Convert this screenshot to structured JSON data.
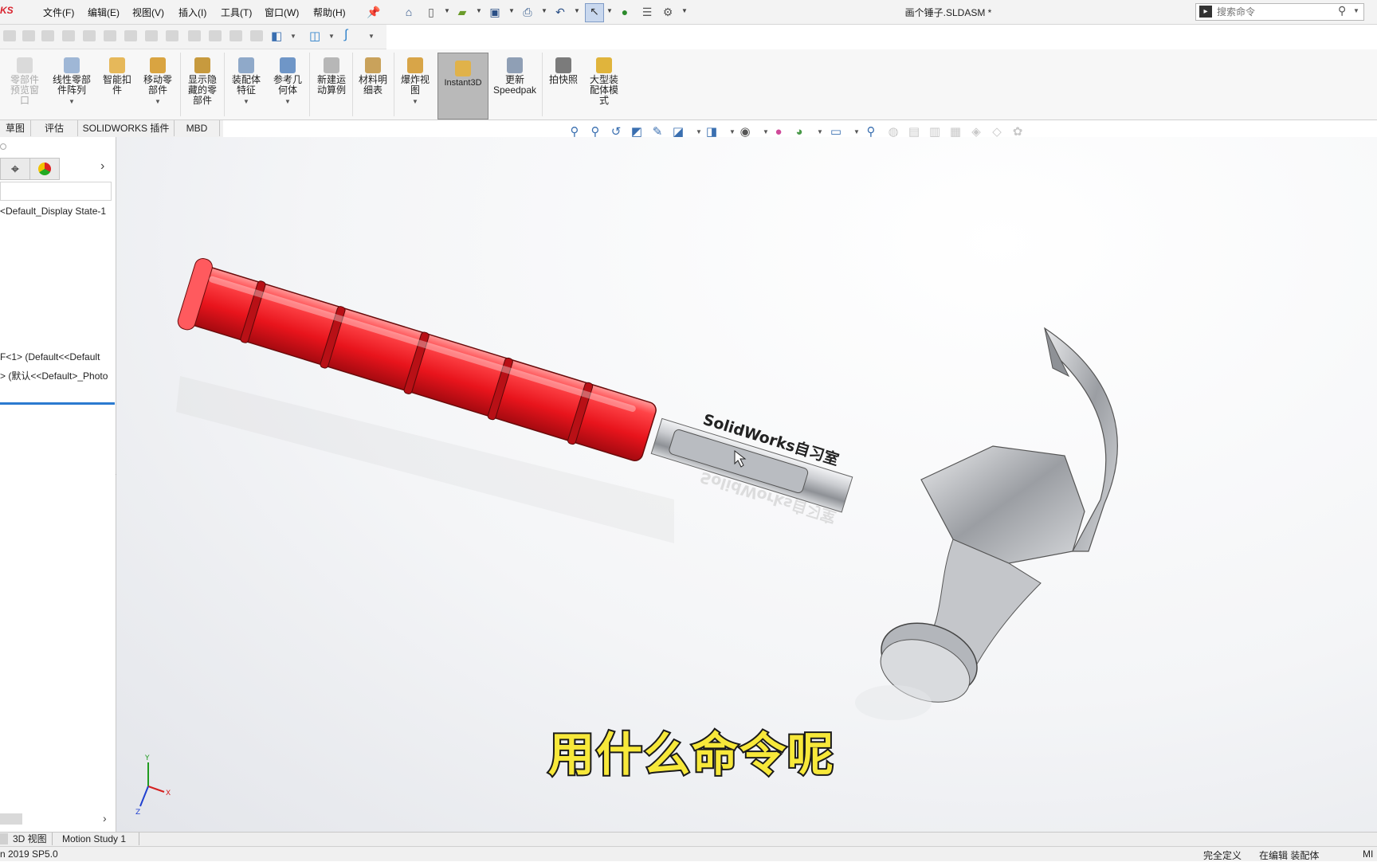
{
  "app": {
    "logo_text": "KS",
    "doc_title": "画个锤子.SLDASM *"
  },
  "menu": [
    "文件(F)",
    "编辑(E)",
    "视图(V)",
    "插入(I)",
    "工具(T)",
    "窗口(W)",
    "帮助(H)"
  ],
  "search": {
    "placeholder": "搜索命令"
  },
  "command_manager": [
    {
      "label": "零部件\n预览窗\n口",
      "disabled": true
    },
    {
      "label": "线性零部\n件阵列",
      "dropdown": true
    },
    {
      "label": "智能扣\n件"
    },
    {
      "label": "移动零\n部件",
      "dropdown": true
    },
    {
      "label": "显示隐\n藏的零\n部件"
    },
    {
      "label": "装配体\n特征",
      "dropdown": true
    },
    {
      "label": "参考几\n何体",
      "dropdown": true
    },
    {
      "label": "新建运\n动算例"
    },
    {
      "label": "材料明\n细表"
    },
    {
      "label": "爆炸视\n图",
      "dropdown": true
    },
    {
      "label": "Instant3D",
      "active": true
    },
    {
      "label": "更新\nSpeedpak"
    },
    {
      "label": "拍快照"
    },
    {
      "label": "大型装\n配体模\n式"
    }
  ],
  "tabs": [
    "草图",
    "评估",
    "SOLIDWORKS 插件",
    "MBD"
  ],
  "tree": {
    "display_state": "<Default_Display State-1",
    "item1": "F<1> (Default<<Default",
    "item2": "> (默认<<Default>_Photo"
  },
  "model": {
    "engraving": "SolidWorks自习室"
  },
  "subtitle": "用什么命令呢",
  "triad": {
    "x": "X",
    "y": "Y",
    "z": "Z"
  },
  "bottom_tabs": [
    "3D 视图",
    "Motion Study 1"
  ],
  "status": {
    "version": "n 2019 SP5.0",
    "definition": "完全定义",
    "editing": "在编辑 装配体",
    "units": "MI"
  },
  "colors": {
    "grip_red": "#e8141c",
    "steel": "#c9cbcf",
    "subtitle": "#f7e83a",
    "logo_red": "#d9232e"
  }
}
